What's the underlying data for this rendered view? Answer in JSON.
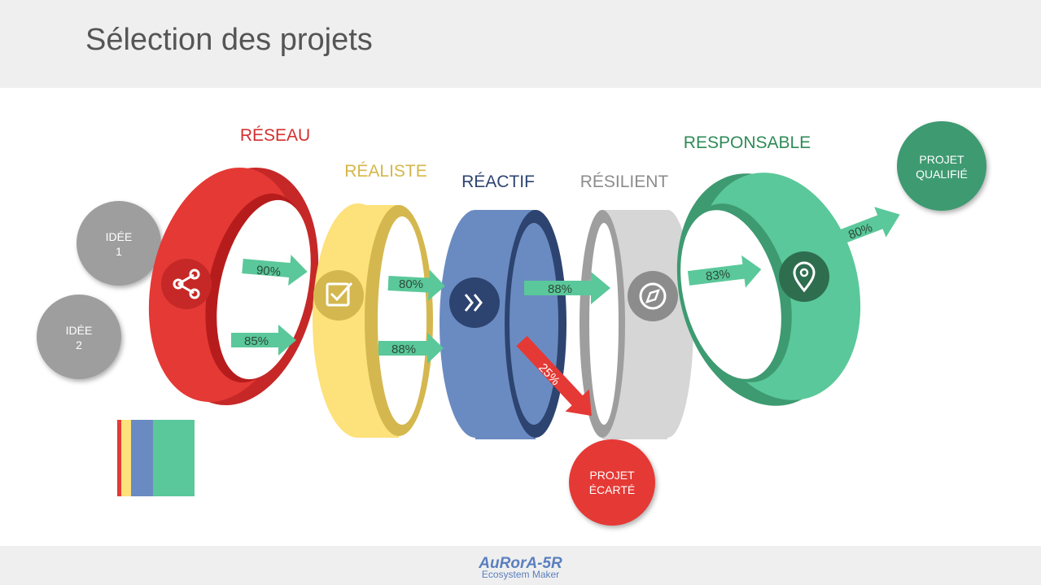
{
  "page": {
    "title": "Sélection des projets"
  },
  "stages": [
    {
      "id": "reseau",
      "label": "RÉSEAU",
      "color": "#d32f2f",
      "icon": "share-icon"
    },
    {
      "id": "realiste",
      "label": "RÉALISTE",
      "color": "#d4b74a",
      "icon": "check-square-icon"
    },
    {
      "id": "reactif",
      "label": "RÉACTIF",
      "color": "#2d4470",
      "icon": "fast-forward-icon"
    },
    {
      "id": "resilient",
      "label": "RÉSILIENT",
      "color": "#8c8c8c",
      "icon": "compass-icon"
    },
    {
      "id": "responsable",
      "label": "RESPONSABLE",
      "color": "#2e8b57",
      "icon": "location-pin-icon"
    }
  ],
  "ideas": [
    {
      "line1": "IDÉE",
      "line2": "1"
    },
    {
      "line1": "IDÉE",
      "line2": "2"
    }
  ],
  "arrows": {
    "reseau_top": "90%",
    "reseau_bottom": "85%",
    "realiste_top": "80%",
    "realiste_bottom": "88%",
    "reactif_out": "88%",
    "reject": "25%",
    "resilient_out": "83%",
    "responsable_out": "80%"
  },
  "outcomes": {
    "qualified": {
      "line1": "PROJET",
      "line2": "QUALIFIÉ"
    },
    "rejected": {
      "line1": "PROJET",
      "line2": "ÉCARTÉ"
    }
  },
  "legend_colors": [
    "#e53935",
    "#fde17a",
    "#6a8bc2",
    "#5ac89a"
  ],
  "footer": {
    "brand": "AuRorA-5R",
    "subtitle": "Ecosystem Maker"
  }
}
